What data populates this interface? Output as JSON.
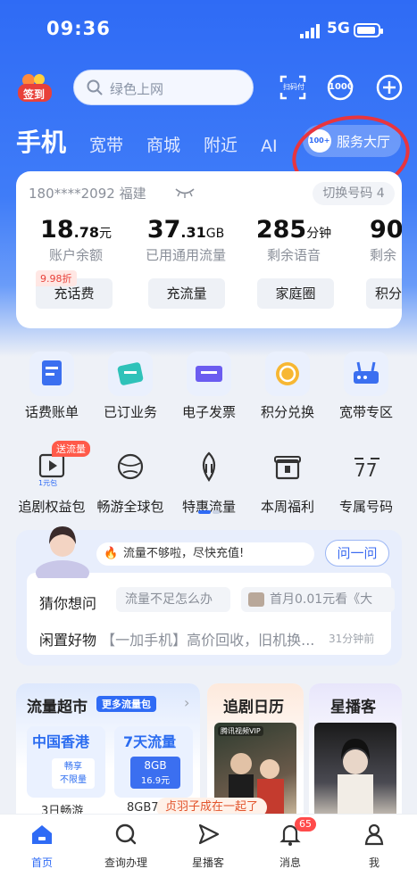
{
  "status_bar": {
    "time": "09:36",
    "network": "5G"
  },
  "header": {
    "signin_label": "签到",
    "search_placeholder": "绿色上网",
    "scan_label": "扫码付",
    "points_label": "1000"
  },
  "tabs": [
    {
      "label": "手机"
    },
    {
      "label": "宽带"
    },
    {
      "label": "商城"
    },
    {
      "label": "附近"
    },
    {
      "label": "AI"
    }
  ],
  "service_hall": {
    "label": "服务大厅",
    "badge": "100+"
  },
  "account": {
    "phone": "180****2092",
    "region": "福建",
    "switch_label": "切换号码",
    "switch_count": "4",
    "stats": [
      {
        "big": "18",
        "small": ".78",
        "unit": "元",
        "label": "账户余额"
      },
      {
        "big": "37",
        "small": ".31",
        "unit": "GB",
        "label": "已用通用流量"
      },
      {
        "big": "285",
        "small": "",
        "unit": "分钟",
        "label": "剩余语音"
      },
      {
        "big": "90",
        "small": "",
        "unit": "",
        "label": "剩余"
      }
    ],
    "buttons": [
      "充话费",
      "充流量",
      "家庭圈",
      "积分"
    ],
    "discount_tag": "9.98折"
  },
  "services_row1": [
    {
      "label": "话费账单",
      "icon": "bill-icon"
    },
    {
      "label": "已订业务",
      "icon": "subscription-icon"
    },
    {
      "label": "电子发票",
      "icon": "invoice-icon"
    },
    {
      "label": "积分兑换",
      "icon": "points-icon"
    },
    {
      "label": "宽带专区",
      "icon": "router-icon"
    }
  ],
  "services_row2": [
    {
      "label": "追剧权益包",
      "icon": "video-icon"
    },
    {
      "label": "畅游全球包",
      "icon": "globe-icon"
    },
    {
      "label": "特惠流量",
      "icon": "data-icon"
    },
    {
      "label": "本周福利",
      "icon": "gift-icon"
    },
    {
      "label": "专属号码",
      "icon": "number-icon"
    }
  ],
  "promo_tag": "送流量",
  "video_icon_caption": "1元包",
  "assistant": {
    "message": "流量不够啦，尽快充值!",
    "ask_label": "问一问",
    "guess_label": "猜你想问",
    "chips": [
      "流量不足怎么办",
      "首月0.01元看《大"
    ],
    "idle_label": "闲置好物",
    "idle_text": "【一加手机】高价回收，旧机换...",
    "idle_time": "31分钟前"
  },
  "market": {
    "title": "流量超市",
    "badge": "更多流量包",
    "pkg1_title": "中国香港",
    "pkg1_sub": "畅享",
    "pkg1_sub2": "不限量",
    "pkg1_label": "3日畅游",
    "pkg2_title": "7天流量",
    "pkg2_size": "8GB",
    "pkg2_price": "16.9元",
    "pkg2_label": "8GB7"
  },
  "drama": {
    "title": "追剧日历",
    "vip": "腾讯视频VIP"
  },
  "star": {
    "title": "星播客"
  },
  "toast": "贞羽子成在一起了",
  "tabbar": [
    {
      "label": "首页"
    },
    {
      "label": "查询办理"
    },
    {
      "label": "星播客"
    },
    {
      "label": "消息",
      "badge": "65"
    },
    {
      "label": "我"
    }
  ],
  "colors": {
    "brand": "#2f6bf5",
    "accent_red": "#e8413a",
    "circle_annotation": "#e8353e"
  }
}
